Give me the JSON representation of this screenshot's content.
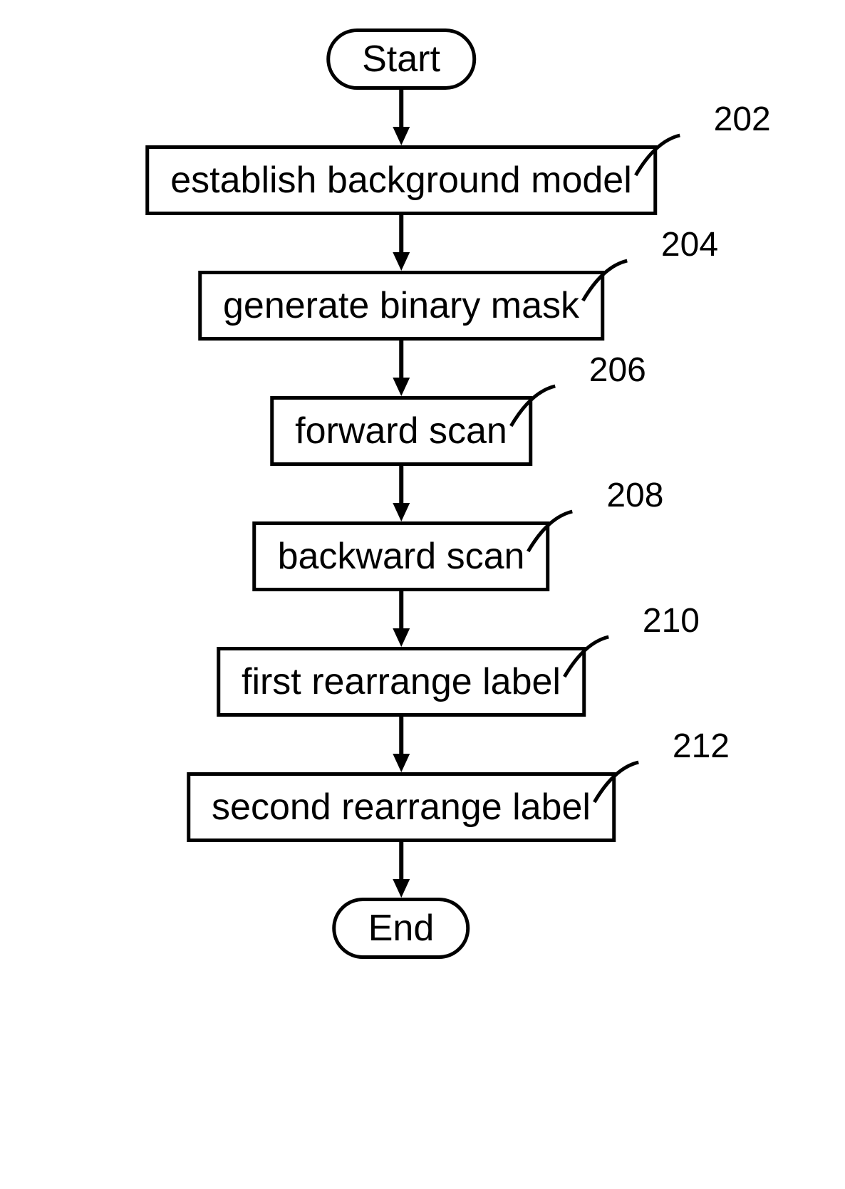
{
  "flowchart": {
    "start": "Start",
    "end": "End",
    "steps": [
      {
        "label": "establish background model",
        "ref": "202"
      },
      {
        "label": "generate binary mask",
        "ref": "204"
      },
      {
        "label": "forward scan",
        "ref": "206"
      },
      {
        "label": "backward scan",
        "ref": "208"
      },
      {
        "label": "first rearrange label",
        "ref": "210"
      },
      {
        "label": "second rearrange label",
        "ref": "212"
      }
    ]
  }
}
